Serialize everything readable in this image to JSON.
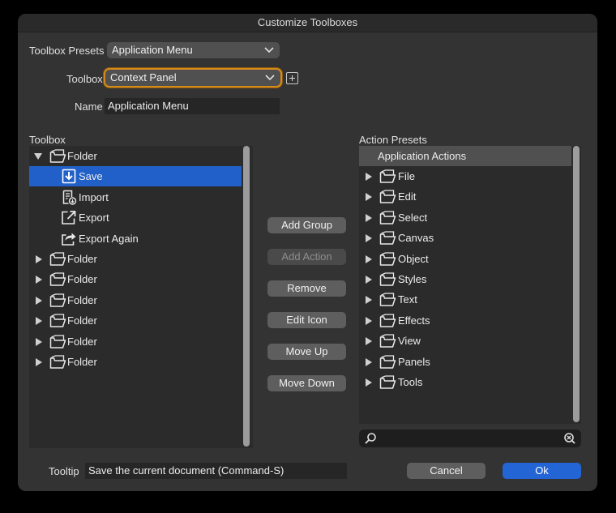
{
  "window": {
    "title": "Customize Toolboxes"
  },
  "form": {
    "presets_label": "Toolbox Presets",
    "presets_value": "Application Menu",
    "toolbox_label": "Toolbox",
    "toolbox_value": "Context Panel",
    "name_label": "Name",
    "name_value": "Application Menu"
  },
  "toolbox_tree": {
    "label": "Toolbox",
    "items": [
      {
        "label": "Folder",
        "icon": "folder-icon",
        "expanded": true,
        "depth": 0
      },
      {
        "label": "Save",
        "icon": "save-icon",
        "selected": true,
        "depth": 1
      },
      {
        "label": "Import",
        "icon": "import-icon",
        "depth": 1
      },
      {
        "label": "Export",
        "icon": "export-icon",
        "depth": 1
      },
      {
        "label": "Export Again",
        "icon": "export-again-icon",
        "depth": 1
      },
      {
        "label": "Folder",
        "icon": "folder-icon",
        "expanded": false,
        "depth": 0
      },
      {
        "label": "Folder",
        "icon": "folder-icon",
        "expanded": false,
        "depth": 0
      },
      {
        "label": "Folder",
        "icon": "folder-icon",
        "expanded": false,
        "depth": 0
      },
      {
        "label": "Folder",
        "icon": "folder-icon",
        "expanded": false,
        "depth": 0
      },
      {
        "label": "Folder",
        "icon": "folder-icon",
        "expanded": false,
        "depth": 0
      },
      {
        "label": "Folder",
        "icon": "folder-icon",
        "expanded": false,
        "depth": 0
      }
    ]
  },
  "middle_buttons": {
    "add_group": "Add Group",
    "add_action": "Add Action",
    "remove": "Remove",
    "edit_icon": "Edit Icon",
    "move_up": "Move Up",
    "move_down": "Move Down"
  },
  "action_presets": {
    "label": "Action Presets",
    "header": "Application Actions",
    "items": [
      "File",
      "Edit",
      "Select",
      "Canvas",
      "Object",
      "Styles",
      "Text",
      "Effects",
      "View",
      "Panels",
      "Tools"
    ]
  },
  "tooltip": {
    "label": "Tooltip",
    "value": "Save the current document (Command-S)"
  },
  "footer": {
    "cancel": "Cancel",
    "ok": "Ok"
  },
  "colors": {
    "selection": "#2160c8",
    "focus_ring": "#d68b18",
    "primary_button": "#2465d6"
  }
}
